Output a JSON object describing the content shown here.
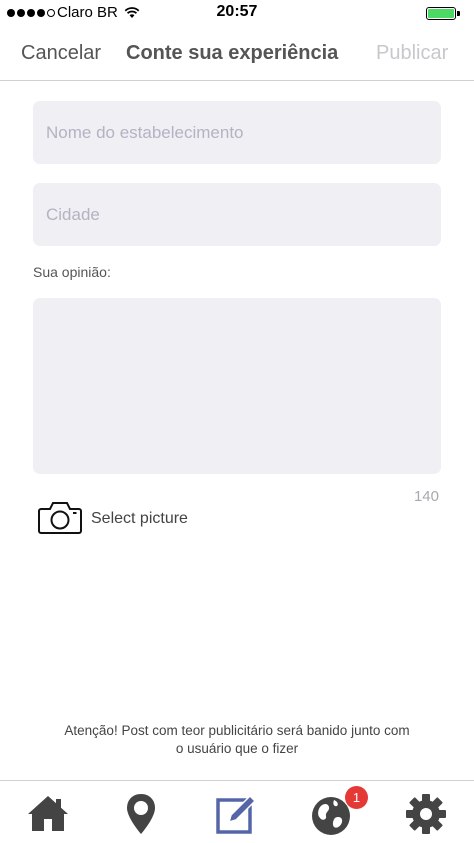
{
  "status_bar": {
    "carrier": "Claro BR",
    "time": "20:57"
  },
  "nav": {
    "cancel_label": "Cancelar",
    "title": "Conte sua experiência",
    "publish_label": "Publicar"
  },
  "form": {
    "name_placeholder": "Nome do estabelecimento",
    "city_placeholder": "Cidade",
    "opinion_label": "Sua opinião:",
    "char_count": "140",
    "select_picture_label": "Select picture"
  },
  "warning": "Atenção! Post com teor publicitário será banido junto com o usuário que o fizer",
  "tab_bar": {
    "active_tab": "edit",
    "items": [
      {
        "icon": "home-icon"
      },
      {
        "icon": "location-pin-icon"
      },
      {
        "icon": "edit-icon"
      },
      {
        "icon": "globe-icon"
      },
      {
        "icon": "gear-icon"
      }
    ],
    "globe_badge": "1"
  },
  "colors": {
    "active_tab": "#5566a8",
    "inactive_tab": "#444444",
    "input_bg": "#efeff4",
    "badge": "#e53935",
    "battery": "#4cd964"
  }
}
